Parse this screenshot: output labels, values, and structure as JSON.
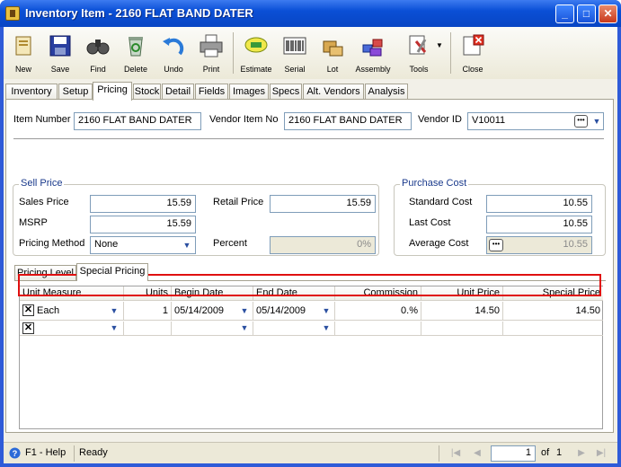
{
  "window": {
    "title": "Inventory Item - 2160 FLAT BAND DATER"
  },
  "toolbar": {
    "new": "New",
    "save": "Save",
    "find": "Find",
    "delete": "Delete",
    "undo": "Undo",
    "print": "Print",
    "estimate": "Estimate",
    "serial": "Serial",
    "lot": "Lot",
    "assembly": "Assembly",
    "tools": "Tools",
    "close": "Close"
  },
  "tabs": [
    "Inventory",
    "Setup",
    "Pricing",
    "Stock",
    "Detail",
    "Fields",
    "Images",
    "Specs",
    "Alt. Vendors",
    "Analysis"
  ],
  "header": {
    "item_number_label": "Item Number",
    "item_number": "2160 FLAT BAND DATER",
    "vendor_item_label": "Vendor Item No",
    "vendor_item": "2160 FLAT BAND DATER",
    "vendor_id_label": "Vendor ID",
    "vendor_id": "V10011"
  },
  "sell": {
    "title": "Sell Price",
    "sales_price_label": "Sales Price",
    "sales_price": "15.59",
    "retail_price_label": "Retail Price",
    "retail_price": "15.59",
    "msrp_label": "MSRP",
    "msrp": "15.59",
    "pricing_method_label": "Pricing Method",
    "pricing_method": "None",
    "percent_label": "Percent",
    "percent": "0%"
  },
  "purchase": {
    "title": "Purchase Cost",
    "standard_label": "Standard Cost",
    "standard": "10.55",
    "last_label": "Last Cost",
    "last": "10.55",
    "average_label": "Average Cost",
    "average": "10.55"
  },
  "subtabs": [
    "Pricing Level",
    "Special Pricing"
  ],
  "grid": {
    "columns": [
      "Unit Measure",
      "Units",
      "Begin Date",
      "End Date",
      "Commission",
      "Unit Price",
      "Special Price"
    ],
    "rows": [
      {
        "unit_measure": "Each",
        "units": "1",
        "begin_date": "05/14/2009",
        "end_date": "05/14/2009",
        "commission": "0.%",
        "unit_price": "14.50",
        "special_price": "14.50"
      }
    ]
  },
  "status": {
    "help": "F1 - Help",
    "state": "Ready",
    "page": "1",
    "of_label": "of",
    "total": "1"
  }
}
